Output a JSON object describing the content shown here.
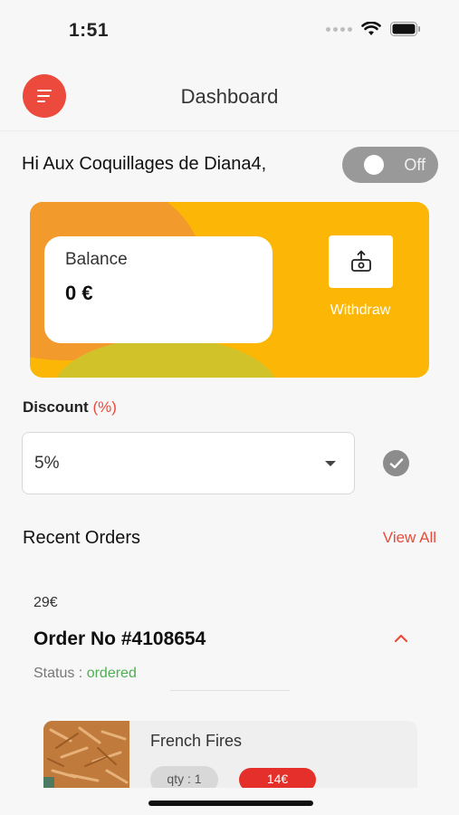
{
  "status_bar": {
    "time": "1:51"
  },
  "header": {
    "title": "Dashboard"
  },
  "greeting": {
    "text": "Hi Aux Coquillages de Diana4,",
    "toggle_label": "Off",
    "toggle_on": false
  },
  "balance": {
    "label": "Balance",
    "value": "0 €",
    "withdraw_label": "Withdraw"
  },
  "discount": {
    "label": "Discount",
    "unit": "(%)",
    "selected": "5%"
  },
  "recent_orders": {
    "title": "Recent Orders",
    "view_all": "View All",
    "order": {
      "price": "29€",
      "number": "Order No #4108654",
      "status_label": "Status :",
      "status_value": "ordered",
      "items": [
        {
          "name": "French Fires",
          "qty": "qty : 1",
          "price": "14€"
        }
      ]
    }
  },
  "colors": {
    "accent": "#ec4a3c",
    "card": "#fbb606",
    "status_ok": "#4caf50"
  },
  "icons": {
    "menu": "menu-icon",
    "withdraw": "withdraw-icon",
    "check": "check-icon",
    "collapse": "chevron-up-icon"
  }
}
